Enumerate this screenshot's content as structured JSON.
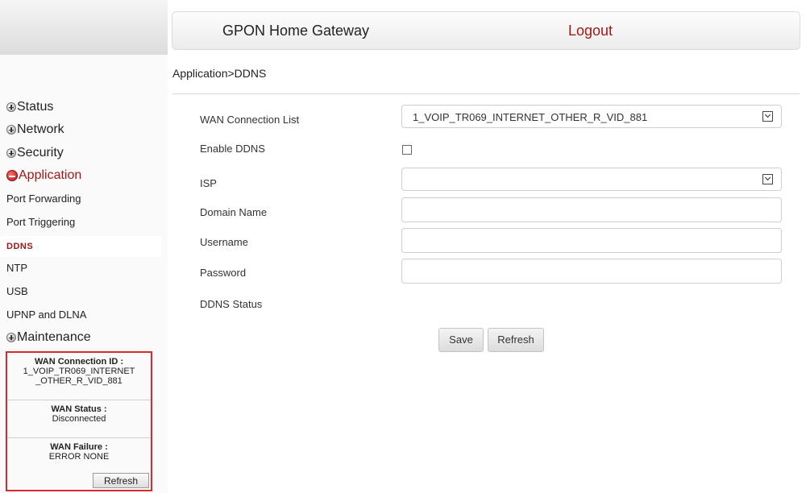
{
  "header": {
    "title": "GPON Home Gateway",
    "logout": "Logout"
  },
  "breadcrumb": "Application>DDNS",
  "sidebar": {
    "menus": [
      {
        "label": "Status",
        "expanded": false
      },
      {
        "label": "Network",
        "expanded": false
      },
      {
        "label": "Security",
        "expanded": false
      },
      {
        "label": "Application",
        "expanded": true
      },
      {
        "label": "Maintenance",
        "expanded": false
      }
    ],
    "sub_items": [
      {
        "label": "Port Forwarding"
      },
      {
        "label": "Port Triggering"
      },
      {
        "label": "DDNS",
        "selected": true
      },
      {
        "label": "NTP"
      },
      {
        "label": "USB"
      },
      {
        "label": "UPNP and DLNA"
      }
    ]
  },
  "status_box": {
    "wan_id_label": "WAN Connection ID :",
    "wan_id_line1": "1_VOIP_TR069_INTERNET",
    "wan_id_line2": "_OTHER_R_VID_881",
    "wan_status_label": "WAN Status :",
    "wan_status_value": "Disconnected",
    "wan_failure_label": "WAN Failure :",
    "wan_failure_value": "ERROR NONE",
    "refresh": "Refresh"
  },
  "form": {
    "wan_list_label": "WAN Connection List",
    "wan_list_value": "1_VOIP_TR069_INTERNET_OTHER_R_VID_881",
    "enable_label": "Enable DDNS",
    "enable_checked": false,
    "isp_label": "ISP",
    "isp_value": "",
    "domain_label": "Domain Name",
    "domain_value": "",
    "username_label": "Username",
    "username_value": "",
    "password_label": "Password",
    "password_value": "",
    "status_label": "DDNS Status",
    "save": "Save",
    "refresh": "Refresh"
  },
  "colors": {
    "accent": "#a01818",
    "status_box_border": "#d92b2b"
  }
}
